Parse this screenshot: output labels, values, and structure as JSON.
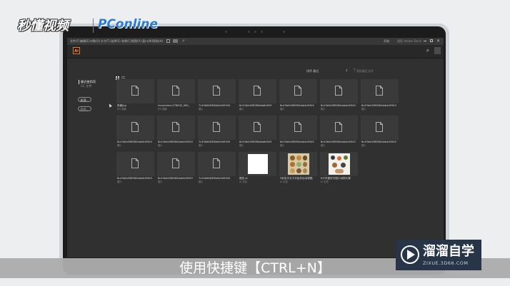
{
  "watermarks": {
    "left_logo": "秒懂视频",
    "pconline": "PConline"
  },
  "menu": {
    "items": [
      "文件(F)",
      "编辑(E)",
      "对象(O)",
      "文字(T)",
      "选择(S)",
      "效果(C)",
      "视图(V)",
      "窗口(W)",
      "帮助(H)"
    ],
    "workspace": "开始",
    "search_placeholder": "搜索 Adobe Stock"
  },
  "app": {
    "logo": "Ai",
    "search_icon": "⌕"
  },
  "sidebar": {
    "recent_label": "最近使用项",
    "cc_files_label": "CC 文件",
    "new_button": "新建...",
    "open_button": "打开..."
  },
  "toolbar": {
    "sort_label": "排序 最近",
    "filter_placeholder": "筛选最近文件"
  },
  "files": [
    {
      "name": "风景jpg",
      "meta": "JPG 图像"
    },
    {
      "name": "mountains-578000_960_",
      "meta": "JPG 图像"
    },
    {
      "name": "7c45b6483f8a9a9d5945",
      "meta": "图片"
    },
    {
      "name": "8c43b0d5f83f8a6a8d945",
      "meta": "图片"
    },
    {
      "name": "8c43b0d3f89f0dab4d5945",
      "meta": "图片"
    },
    {
      "name": "8c43b0d3f8580dab4d5945",
      "meta": "图片"
    },
    {
      "name": "8c43b0d3f8580dab4d5945",
      "meta": "图片"
    },
    {
      "name": "8c43b0d3f8580dab4d5945",
      "meta": "图片"
    },
    {
      "name": "8c43b0d3f8580dab4d5945",
      "meta": "图片"
    },
    {
      "name": "7c45b6483f8a9a9d5945",
      "meta": "图片"
    },
    {
      "name": "8c43b0d5f83f8a6a8d945",
      "meta": "图片"
    },
    {
      "name": "8c43b0d3f89f0dab4d5945",
      "meta": "图片"
    },
    {
      "name": "8c43b0d3f8580dab4d5945",
      "meta": "图片"
    },
    {
      "name": "8c43b0d3f8580dab4d5945",
      "meta": "图片"
    },
    {
      "name": "8c43b0d3f8580dab4d5945",
      "meta": "图片"
    },
    {
      "name": "8c43b0d3f8580dab4d5945",
      "meta": "图片"
    },
    {
      "name": "7c45b6483f8a9a9d5945",
      "meta": "图片"
    },
    {
      "name": "图形.ai",
      "meta": "AI 文档"
    },
    {
      "name": "5彩色平文卡手绘作出动物图",
      "meta": "AI 文档"
    },
    {
      "name": "6卡可爱彩中国小动物头像",
      "meta": "AI 文档"
    }
  ],
  "subtitle": "使用快捷键【CTRL+N】",
  "brand": {
    "name": "溜溜自学",
    "url": "ZIXUE.3D66.COM"
  },
  "colors": {
    "screen_bg": "#303030",
    "tile_bg": "#3a3a3a",
    "ai_orange": "#f39c3b",
    "brand_bg": "#283447"
  }
}
